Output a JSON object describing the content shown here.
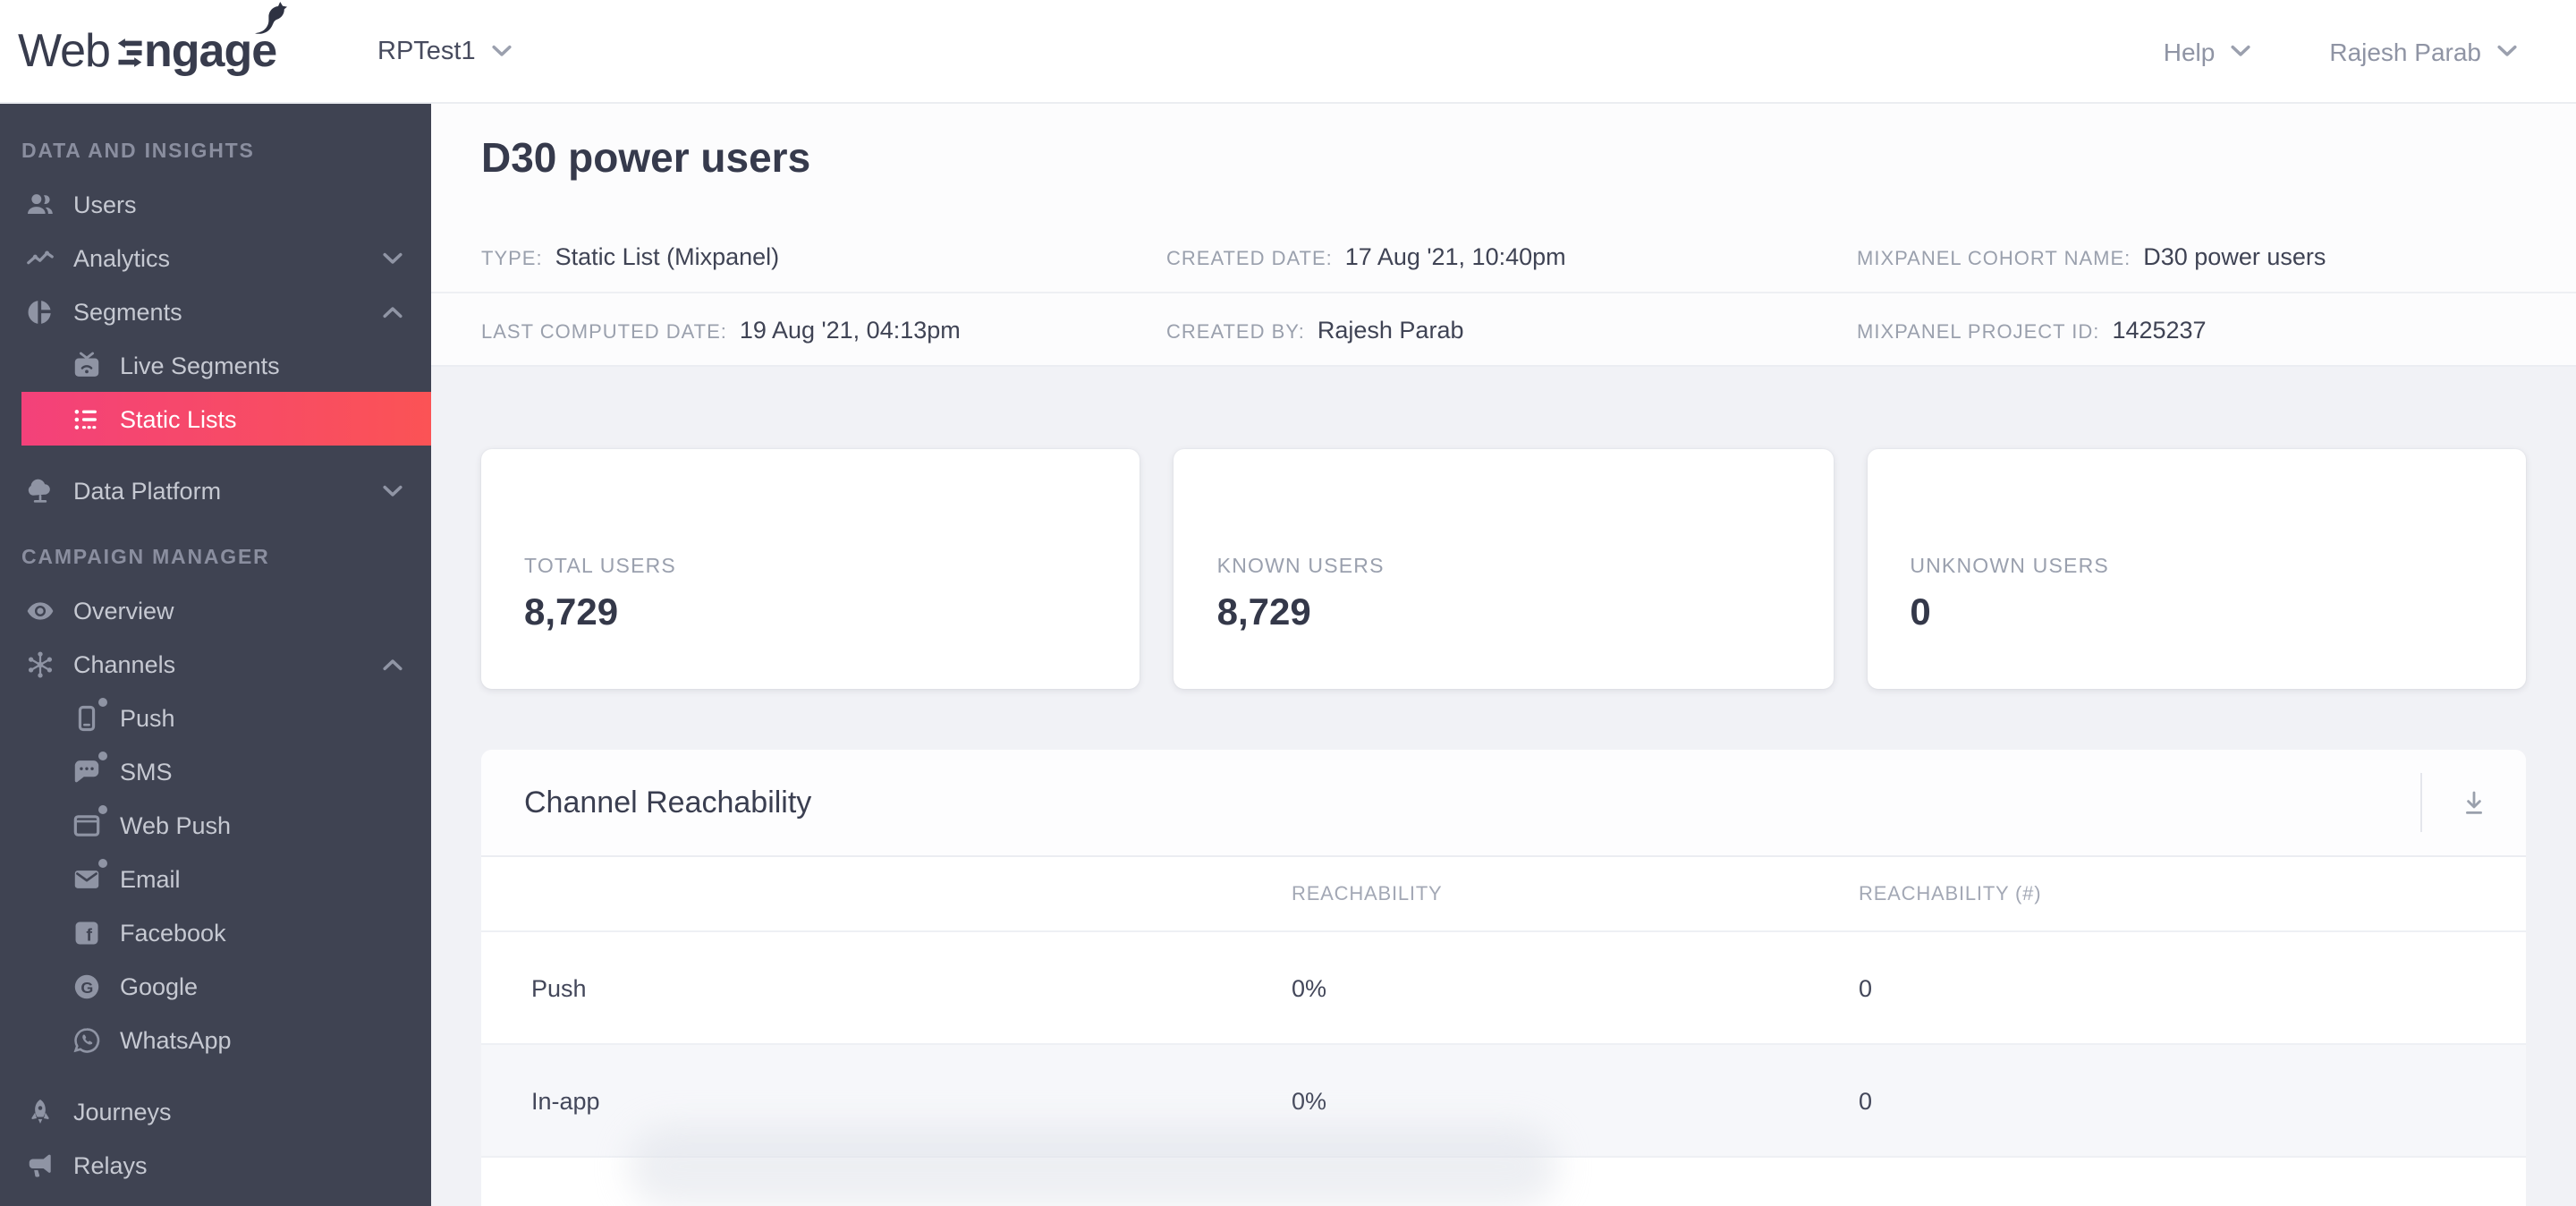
{
  "header": {
    "logo_web": "Web",
    "logo_ngage": "ngage",
    "project_selector": "RPTest1",
    "help_label": "Help",
    "user_name": "Rajesh Parab"
  },
  "colors": {
    "accent_gradient_start": "#f3417a",
    "accent_gradient_end": "#fb5355",
    "sidebar_bg": "#3f4352",
    "page_bg": "#f1f2f6"
  },
  "sidebar": {
    "sections": [
      {
        "label": "DATA AND INSIGHTS",
        "items": [
          {
            "label": "Users",
            "icon": "users-icon"
          },
          {
            "label": "Analytics",
            "icon": "analytics-icon",
            "chevron": "down"
          },
          {
            "label": "Segments",
            "icon": "segments-icon",
            "chevron": "up"
          },
          {
            "label": "Live Segments",
            "icon": "live-segments-icon",
            "sub": true
          },
          {
            "label": "Static Lists",
            "icon": "static-lists-icon",
            "sub": true,
            "active": true
          },
          {
            "label": "Data Platform",
            "icon": "data-platform-icon",
            "chevron": "down"
          }
        ]
      },
      {
        "label": "CAMPAIGN MANAGER",
        "items": [
          {
            "label": "Overview",
            "icon": "eye-icon"
          },
          {
            "label": "Channels",
            "icon": "channels-icon",
            "chevron": "up"
          },
          {
            "label": "Push",
            "icon": "mobile-push-icon",
            "sub": true,
            "dot": true
          },
          {
            "label": "SMS",
            "icon": "sms-icon",
            "sub": true,
            "dot": true
          },
          {
            "label": "Web Push",
            "icon": "web-push-icon",
            "sub": true,
            "dot": true
          },
          {
            "label": "Email",
            "icon": "email-icon",
            "sub": true,
            "dot": true
          },
          {
            "label": "Facebook",
            "icon": "facebook-icon",
            "sub": true
          },
          {
            "label": "Google",
            "icon": "google-icon",
            "sub": true
          },
          {
            "label": "WhatsApp",
            "icon": "whatsapp-icon",
            "sub": true
          },
          {
            "label": "Journeys",
            "icon": "rocket-icon"
          },
          {
            "label": "Relays",
            "icon": "megaphone-icon"
          }
        ]
      }
    ]
  },
  "icons": {
    "facebook_glyph": "f",
    "google_glyph": "G"
  },
  "page": {
    "title": "D30 power users",
    "meta_row1": [
      {
        "label": "TYPE:",
        "value": "Static List (Mixpanel)"
      },
      {
        "label": "CREATED DATE:",
        "value": "17 Aug '21, 10:40pm"
      },
      {
        "label": "MIXPANEL COHORT NAME:",
        "value": "D30 power users"
      }
    ],
    "meta_row2": [
      {
        "label": "LAST COMPUTED DATE:",
        "value": "19 Aug '21, 04:13pm"
      },
      {
        "label": "CREATED BY:",
        "value": "Rajesh Parab"
      },
      {
        "label": "MIXPANEL PROJECT ID:",
        "value": "1425237"
      }
    ]
  },
  "stats_cards": [
    {
      "label": "TOTAL USERS",
      "value": "8,729"
    },
    {
      "label": "KNOWN USERS",
      "value": "8,729"
    },
    {
      "label": "UNKNOWN USERS",
      "value": "0"
    }
  ],
  "reachability": {
    "title": "Channel Reachability",
    "columns": {
      "col2": "REACHABILITY",
      "col3": "REACHABILITY (#)"
    },
    "rows": [
      {
        "channel": "Push",
        "reachability": "0%",
        "count": "0"
      },
      {
        "channel": "In-app",
        "reachability": "0%",
        "count": "0"
      }
    ]
  }
}
